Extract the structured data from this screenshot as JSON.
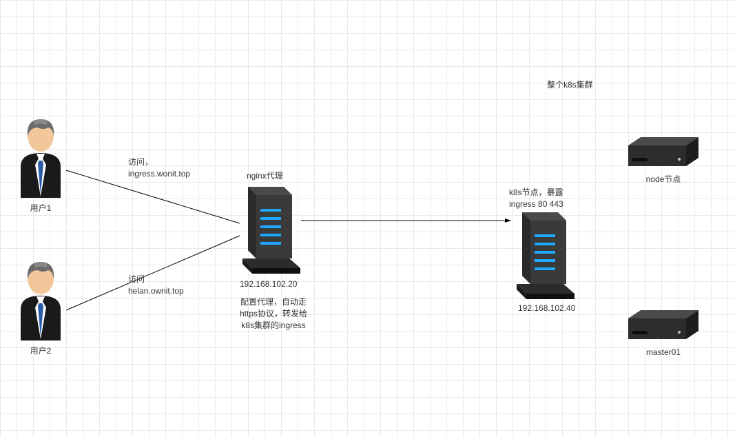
{
  "cluster_title": "整个k8s集群",
  "user1": {
    "caption": "用户1"
  },
  "user2": {
    "caption": "用户2"
  },
  "edge1": {
    "text": "访问，\ningress.wonit.top"
  },
  "edge2": {
    "text": "访问\nhelan.ownit.top"
  },
  "nginx": {
    "title": "nginx代理",
    "ip": "192.168.102.20",
    "desc": "配置代理，自动走\nhttps协议，转发给\nk8s集群的ingress"
  },
  "k8s_node": {
    "title": "k8s节点，暴露\ningress 80 443",
    "ip": "192.168.102.40"
  },
  "node": {
    "caption": "node节点"
  },
  "master": {
    "caption": "master01"
  }
}
